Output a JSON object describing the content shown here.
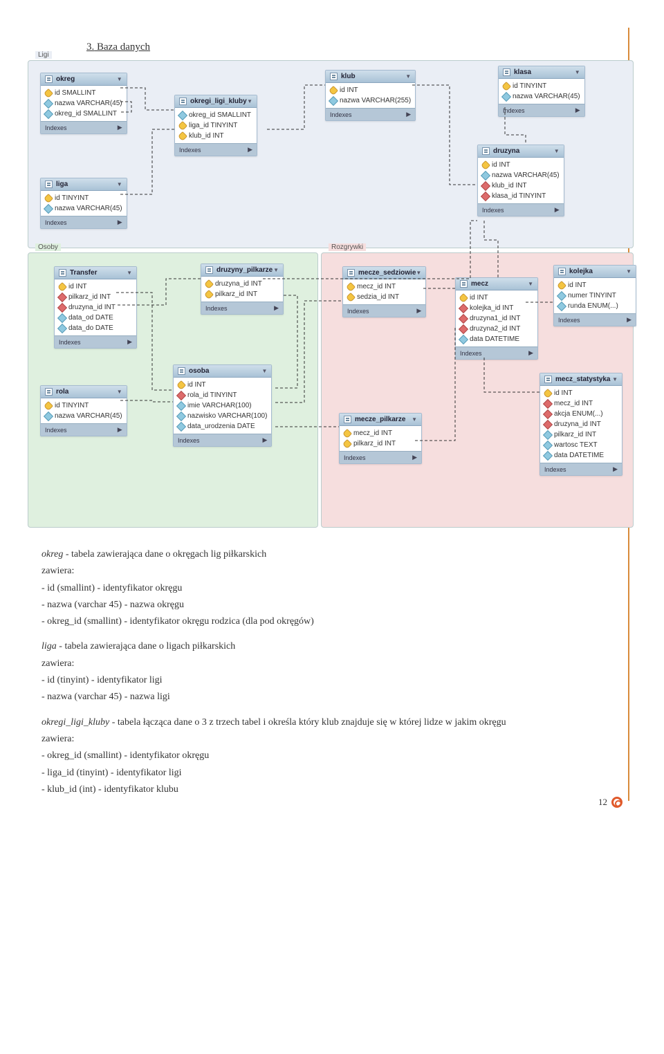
{
  "section_number": "3.",
  "section_title": "Baza danych",
  "page_number": "12",
  "regions": {
    "ligi": "Ligi",
    "osoby": "Osoby",
    "rozgrywki": "Rozgrywki"
  },
  "indexes_label": "Indexes",
  "tables": {
    "okreg": {
      "name": "okreg",
      "fields": [
        {
          "ic": "pk",
          "label": "id SMALLINT"
        },
        {
          "ic": "attr",
          "label": "nazwa VARCHAR(45)"
        },
        {
          "ic": "attr",
          "label": "okreg_id SMALLINT"
        }
      ]
    },
    "liga": {
      "name": "liga",
      "fields": [
        {
          "ic": "pk",
          "label": "id TINYINT"
        },
        {
          "ic": "attr",
          "label": "nazwa VARCHAR(45)"
        }
      ]
    },
    "okregi_ligi_kluby": {
      "name": "okregi_ligi_kluby",
      "fields": [
        {
          "ic": "attr",
          "label": "okreg_id SMALLINT"
        },
        {
          "ic": "pk",
          "label": "liga_id TINYINT"
        },
        {
          "ic": "pk",
          "label": "klub_id INT"
        }
      ]
    },
    "klub": {
      "name": "klub",
      "fields": [
        {
          "ic": "pk",
          "label": "id INT"
        },
        {
          "ic": "attr",
          "label": "nazwa VARCHAR(255)"
        }
      ]
    },
    "klasa": {
      "name": "klasa",
      "fields": [
        {
          "ic": "pk",
          "label": "id TINYINT"
        },
        {
          "ic": "attr",
          "label": "nazwa VARCHAR(45)"
        }
      ]
    },
    "druzyna": {
      "name": "druzyna",
      "fields": [
        {
          "ic": "pk",
          "label": "id INT"
        },
        {
          "ic": "attr",
          "label": "nazwa VARCHAR(45)"
        },
        {
          "ic": "fk",
          "label": "klub_id INT"
        },
        {
          "ic": "fk",
          "label": "klasa_id TINYINT"
        }
      ]
    },
    "transfer": {
      "name": "Transfer",
      "fields": [
        {
          "ic": "pk",
          "label": "id INT"
        },
        {
          "ic": "fk",
          "label": "pilkarz_id INT"
        },
        {
          "ic": "fk",
          "label": "druzyna_id INT"
        },
        {
          "ic": "attr",
          "label": "data_od DATE"
        },
        {
          "ic": "attr",
          "label": "data_do DATE"
        }
      ]
    },
    "druzyny_pilkarze": {
      "name": "druzyny_pilkarze",
      "fields": [
        {
          "ic": "pk",
          "label": "druzyna_id INT"
        },
        {
          "ic": "pk",
          "label": "pilkarz_id INT"
        }
      ]
    },
    "rola": {
      "name": "rola",
      "fields": [
        {
          "ic": "pk",
          "label": "id TINYINT"
        },
        {
          "ic": "attr",
          "label": "nazwa VARCHAR(45)"
        }
      ]
    },
    "osoba": {
      "name": "osoba",
      "fields": [
        {
          "ic": "pk",
          "label": "id INT"
        },
        {
          "ic": "fk",
          "label": "rola_id TINYINT"
        },
        {
          "ic": "attr",
          "label": "imie VARCHAR(100)"
        },
        {
          "ic": "attr",
          "label": "nazwisko VARCHAR(100)"
        },
        {
          "ic": "attr",
          "label": "data_urodzenia DATE"
        }
      ]
    },
    "mecze_sedziowie": {
      "name": "mecze_sedziowie",
      "fields": [
        {
          "ic": "pk",
          "label": "mecz_id INT"
        },
        {
          "ic": "pk",
          "label": "sedzia_id INT"
        }
      ]
    },
    "mecz": {
      "name": "mecz",
      "fields": [
        {
          "ic": "pk",
          "label": "id INT"
        },
        {
          "ic": "fk",
          "label": "kolejka_id INT"
        },
        {
          "ic": "fk",
          "label": "druzyna1_id INT"
        },
        {
          "ic": "fk",
          "label": "druzyna2_id INT"
        },
        {
          "ic": "attr",
          "label": "data DATETIME"
        }
      ]
    },
    "kolejka": {
      "name": "kolejka",
      "fields": [
        {
          "ic": "pk",
          "label": "id INT"
        },
        {
          "ic": "attr",
          "label": "numer TINYINT"
        },
        {
          "ic": "attr",
          "label": "runda ENUM(...)"
        }
      ]
    },
    "mecze_pilkarze": {
      "name": "mecze_pilkarze",
      "fields": [
        {
          "ic": "pk",
          "label": "mecz_id INT"
        },
        {
          "ic": "pk",
          "label": "pilkarz_id INT"
        }
      ]
    },
    "mecz_statystyka": {
      "name": "mecz_statystyka",
      "fields": [
        {
          "ic": "pk",
          "label": "id INT"
        },
        {
          "ic": "fk",
          "label": "mecz_id INT"
        },
        {
          "ic": "fk",
          "label": "akcja ENUM(...)"
        },
        {
          "ic": "fk",
          "label": "druzyna_id INT"
        },
        {
          "ic": "attr",
          "label": "pilkarz_id INT"
        },
        {
          "ic": "attr",
          "label": "wartosc TEXT"
        },
        {
          "ic": "attr",
          "label": "data DATETIME"
        }
      ]
    }
  },
  "descriptions": [
    {
      "name": "okreg",
      "title_text": " - tabela zawierająca dane o okręgach lig piłkarskich",
      "lines": [
        "zawiera:",
        "- id (smallint) - identyfikator okręgu",
        "- nazwa (varchar 45) - nazwa okręgu",
        "- okreg_id (smallint) - identyfikator okręgu rodzica (dla pod okręgów)"
      ]
    },
    {
      "name": "liga",
      "title_text": " - tabela zawierająca dane o ligach piłkarskich",
      "lines": [
        "zawiera:",
        "- id (tinyint) - identyfikator ligi",
        "- nazwa (varchar 45) - nazwa ligi"
      ]
    },
    {
      "name": "okregi_ligi_kluby",
      "title_text": " - tabela łącząca dane o 3 z trzech tabel i określa który klub znajduje się w której lidze w jakim okręgu",
      "lines": [
        "zawiera:",
        "- okreg_id (smallint) - identyfikator okręgu",
        "- liga_id (tinyint) - identyfikator ligi",
        "- klub_id (int) - identyfikator klubu"
      ]
    }
  ]
}
